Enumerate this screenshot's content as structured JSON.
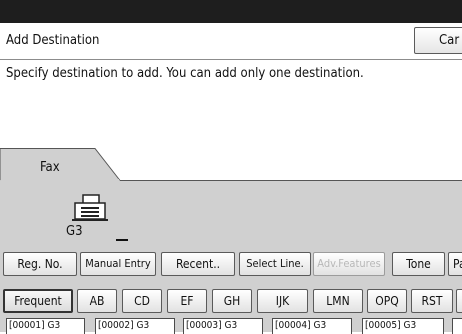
{
  "header": {
    "title": "Add Destination",
    "cancel_label": "Car"
  },
  "message": "Specify destination to add. You can add only one destination.",
  "tabs": [
    {
      "label": "Fax"
    }
  ],
  "fax_panel": {
    "mode": "G3",
    "icon": "fax-machine-icon"
  },
  "toolbar": {
    "reg_no": "Reg. No.",
    "manual_entry": "Manual Entry",
    "recent": "Recent",
    "select_line": "Select Line",
    "adv_features": "Adv.Features",
    "tone": "Tone",
    "pa": "Pa"
  },
  "index_tabs": [
    "Frequent",
    "AB",
    "CD",
    "EF",
    "GH",
    "IJK",
    "LMN",
    "OPQ",
    "RST"
  ],
  "entries": [
    "[00001] G3",
    "[00002] G3",
    "[00003] G3",
    "[00004] G3",
    "[00005] G3",
    ""
  ]
}
